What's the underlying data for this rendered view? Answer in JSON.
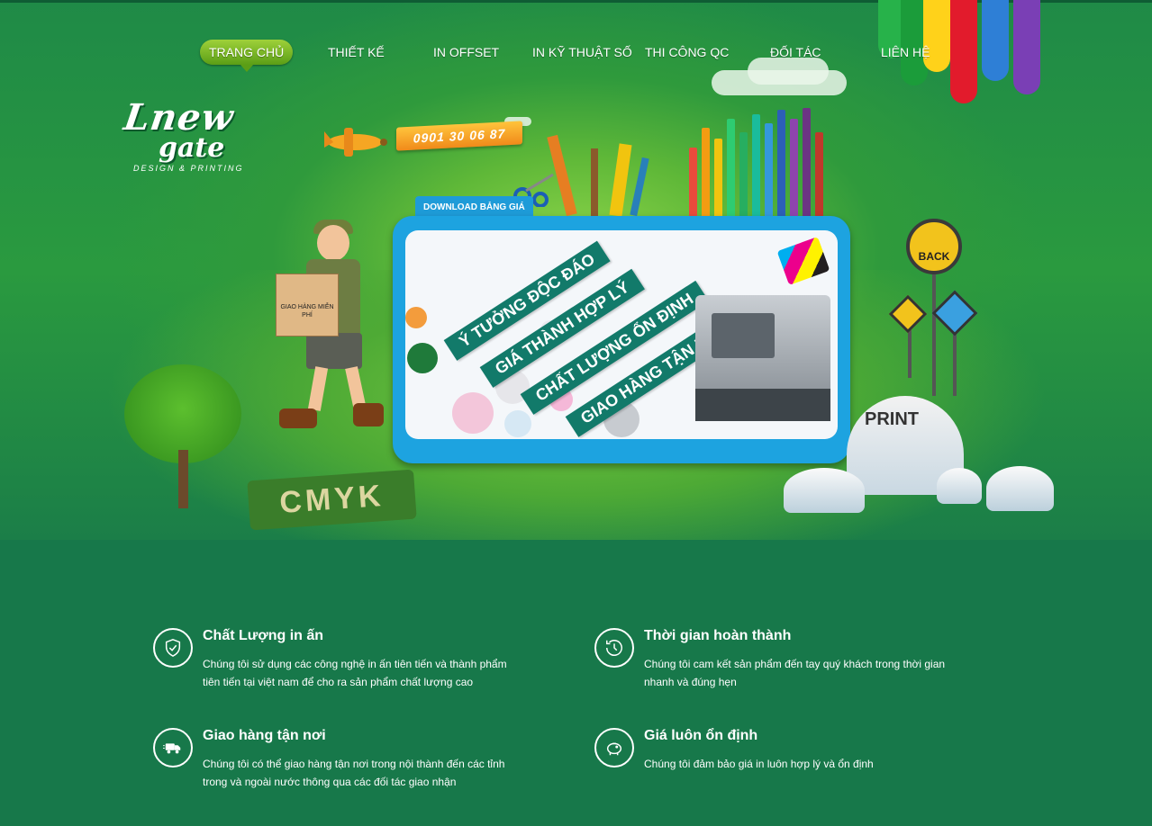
{
  "nav": {
    "items": [
      {
        "label": "TRANG CHỦ",
        "active": true
      },
      {
        "label": "THIẾT KẾ",
        "active": false
      },
      {
        "label": "IN OFFSET",
        "active": false
      },
      {
        "label": "IN KỸ THUẬT SỐ",
        "active": false
      },
      {
        "label": "THI CÔNG QC",
        "active": false
      },
      {
        "label": "ĐỐI TÁC",
        "active": false
      },
      {
        "label": "LIÊN HỆ",
        "active": false
      }
    ]
  },
  "logo": {
    "line1": "Lnew",
    "line2": "gate",
    "tagline": "DESIGN & PRINTING"
  },
  "hero": {
    "phone": "0901 30 06 87",
    "download_label": "DOWNLOAD BẢNG GIÁ",
    "ribbons": [
      "Ý TƯỞNG ĐỘC ĐÁO",
      "GIÁ THÀNH HỢP LÝ",
      "CHẤT LƯỢNG ỔN ĐỊNH",
      "GIAO HÀNG TẬN NƠI"
    ],
    "box_label": "GIAO HÀNG MIỄN PHÍ",
    "back_sign": "BACK",
    "dome_text": "PRINT",
    "cmyk_text": "CMYK"
  },
  "features": [
    {
      "icon": "shield-check-icon",
      "title": "Chất Lượng in ấn",
      "desc": "Chúng tôi sử dụng các công nghệ in ấn tiên tiến và thành phẩm tiên tiến tại việt nam để cho ra sản phẩm chất lượng cao"
    },
    {
      "icon": "clock-history-icon",
      "title": "Thời gian hoàn thành",
      "desc": "Chúng tôi cam kết sản phẩm đến tay quý khách trong thời gian nhanh và đúng hẹn"
    },
    {
      "icon": "delivery-truck-icon",
      "title": "Giao hàng tận nơi",
      "desc": "Chúng tôi có thể giao hàng tận nơi trong nội thành đến các tỉnh trong và ngoài nước thông qua các đối tác giao nhận"
    },
    {
      "icon": "piggy-bank-icon",
      "title": "Giá luôn ổn định",
      "desc": "Chúng tôi đảm bảo giá  in luôn hợp lý và ổn định"
    }
  ],
  "colors": {
    "background": "#17784a",
    "nav_active": "#7dbb22",
    "board": "#1da3e0",
    "ribbon": "#127a6a"
  }
}
